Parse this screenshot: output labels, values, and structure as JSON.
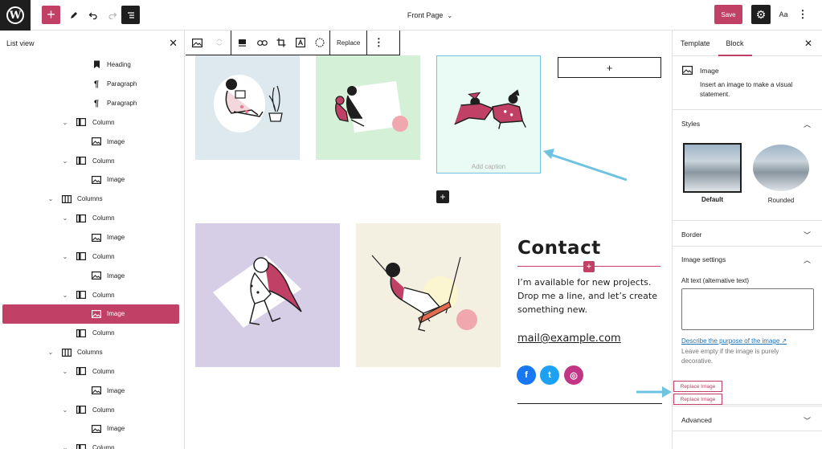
{
  "topbar": {
    "logo_letter": "W",
    "add_icon": "+",
    "document_title": "Front Page",
    "save_label": "Save",
    "styles_label": "Aa"
  },
  "listview": {
    "title": "List view",
    "rows": [
      {
        "label": "Heading",
        "icon": "bookmark-icon",
        "level": 4,
        "toggle": false,
        "selected": false
      },
      {
        "label": "Paragraph",
        "icon": "paragraph-icon",
        "level": 4,
        "toggle": false,
        "selected": false
      },
      {
        "label": "Paragraph",
        "icon": "paragraph-icon",
        "level": 4,
        "toggle": false,
        "selected": false
      },
      {
        "label": "Column",
        "icon": "column-icon",
        "level": 3,
        "toggle": true,
        "selected": false
      },
      {
        "label": "Image",
        "icon": "image-icon",
        "level": 4,
        "toggle": false,
        "selected": false
      },
      {
        "label": "Column",
        "icon": "column-icon",
        "level": 3,
        "toggle": true,
        "selected": false
      },
      {
        "label": "Image",
        "icon": "image-icon",
        "level": 4,
        "toggle": false,
        "selected": false
      },
      {
        "label": "Columns",
        "icon": "columns-icon",
        "level": 2,
        "toggle": true,
        "selected": false
      },
      {
        "label": "Column",
        "icon": "column-icon",
        "level": 3,
        "toggle": true,
        "selected": false
      },
      {
        "label": "Image",
        "icon": "image-icon",
        "level": 4,
        "toggle": false,
        "selected": false
      },
      {
        "label": "Column",
        "icon": "column-icon",
        "level": 3,
        "toggle": true,
        "selected": false
      },
      {
        "label": "Image",
        "icon": "image-icon",
        "level": 4,
        "toggle": false,
        "selected": false
      },
      {
        "label": "Column",
        "icon": "column-icon",
        "level": 3,
        "toggle": true,
        "selected": false
      },
      {
        "label": "Image",
        "icon": "image-icon",
        "level": 4,
        "toggle": false,
        "selected": true
      },
      {
        "label": "Column",
        "icon": "column-icon",
        "level": 3,
        "toggle": false,
        "selected": false
      },
      {
        "label": "Columns",
        "icon": "columns-icon",
        "level": 2,
        "toggle": true,
        "selected": false
      },
      {
        "label": "Column",
        "icon": "column-icon",
        "level": 3,
        "toggle": true,
        "selected": false
      },
      {
        "label": "Image",
        "icon": "image-icon",
        "level": 4,
        "toggle": false,
        "selected": false
      },
      {
        "label": "Column",
        "icon": "column-icon",
        "level": 3,
        "toggle": true,
        "selected": false
      },
      {
        "label": "Image",
        "icon": "image-icon",
        "level": 4,
        "toggle": false,
        "selected": false
      },
      {
        "label": "Column",
        "icon": "column-icon",
        "level": 3,
        "toggle": true,
        "selected": false
      }
    ]
  },
  "block_toolbar": {
    "replace_label": "Replace"
  },
  "canvas": {
    "caption_placeholder": "Add caption",
    "contact": {
      "title": "Contact",
      "body": "I’m available for new projects. Drop me a line, and let’s create something new.",
      "email": "mail@example.com"
    },
    "social": [
      {
        "name": "facebook",
        "glyph": "f",
        "color": "#1877f2"
      },
      {
        "name": "twitter",
        "glyph": "t",
        "color": "#1da1f2"
      },
      {
        "name": "instagram",
        "glyph": "◎",
        "color": "#c13584"
      }
    ]
  },
  "sidebar": {
    "tabs": [
      "Template",
      "Block"
    ],
    "active_tab": "Block",
    "block": {
      "name": "Image",
      "description": "Insert an image to make a visual statement."
    },
    "styles": {
      "title": "Styles",
      "options": [
        {
          "label": "Default",
          "selected": true
        },
        {
          "label": "Rounded",
          "selected": false
        }
      ]
    },
    "border": {
      "title": "Border"
    },
    "image_settings": {
      "title": "Image settings",
      "alt_label": "Alt text (alternative text)",
      "alt_value": "",
      "describe_link": "Describe the purpose of the image",
      "help": "Leave empty if the image is purely decorative."
    },
    "replace_buttons": [
      "Replace Image",
      "Replace Image"
    ],
    "advanced": {
      "title": "Advanced"
    }
  },
  "colors": {
    "accent": "#c04066",
    "dark": "#1e1e1e",
    "link": "#2271b1",
    "annotation_arrow": "#6ec4e0"
  }
}
